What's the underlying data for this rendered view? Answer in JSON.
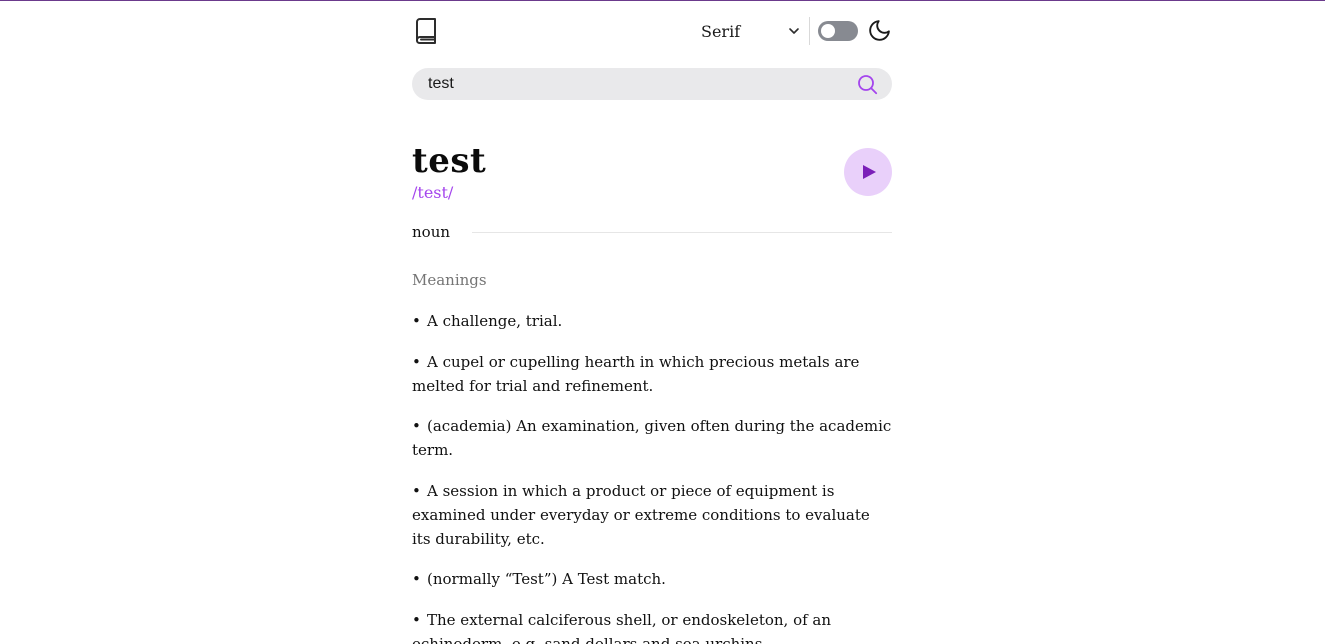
{
  "header": {
    "logo_icon": "book-icon",
    "font_select": {
      "selected": "Serif",
      "icon": "chevron-down-icon"
    },
    "theme_toggle": {
      "state": "off",
      "icon": "moon-icon"
    }
  },
  "search": {
    "value": "test",
    "placeholder": "",
    "icon": "search-icon"
  },
  "entry": {
    "word": "test",
    "phonetic": "/test/",
    "play_icon": "play-icon",
    "part_of_speech": "noun",
    "meanings_heading": "Meanings",
    "definitions": [
      "A challenge, trial.",
      "A cupel or cupelling hearth in which precious metals are melted for trial and refinement.",
      "(academia) An examination, given often during the academic term.",
      "A session in which a product or piece of equipment is examined under everyday or extreme conditions to evaluate its durability, etc.",
      "(normally “Test”) A Test match.",
      "The external calciferous shell, or endoskeleton, of an echinoderm, e.g. sand dollars and sea urchins."
    ]
  },
  "colors": {
    "accent": "#a445ed",
    "play_bg": "#e9d0fa",
    "search_bg": "#e9e9eb",
    "toggle_bg": "#878a91"
  }
}
